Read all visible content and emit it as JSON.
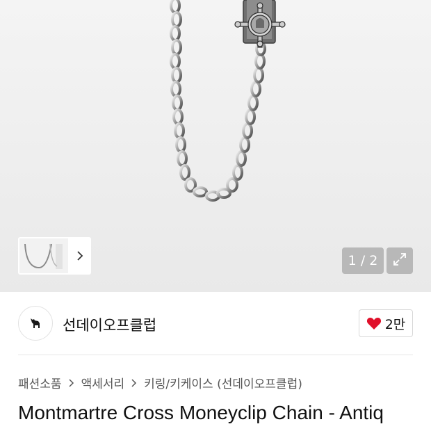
{
  "gallery": {
    "counter": "1 / 2",
    "colors": {
      "background": "#efefef",
      "overlay": "#969696"
    }
  },
  "brand": {
    "name": "선데이오프클럽",
    "likes": "2만",
    "heart_color": "#e0102a"
  },
  "breadcrumb": [
    "패션소품",
    "액세서리",
    "키링/키케이스 (선데이오프클럽)"
  ],
  "product": {
    "title": "Montmartre Cross Moneyclip Chain - Antiq"
  }
}
